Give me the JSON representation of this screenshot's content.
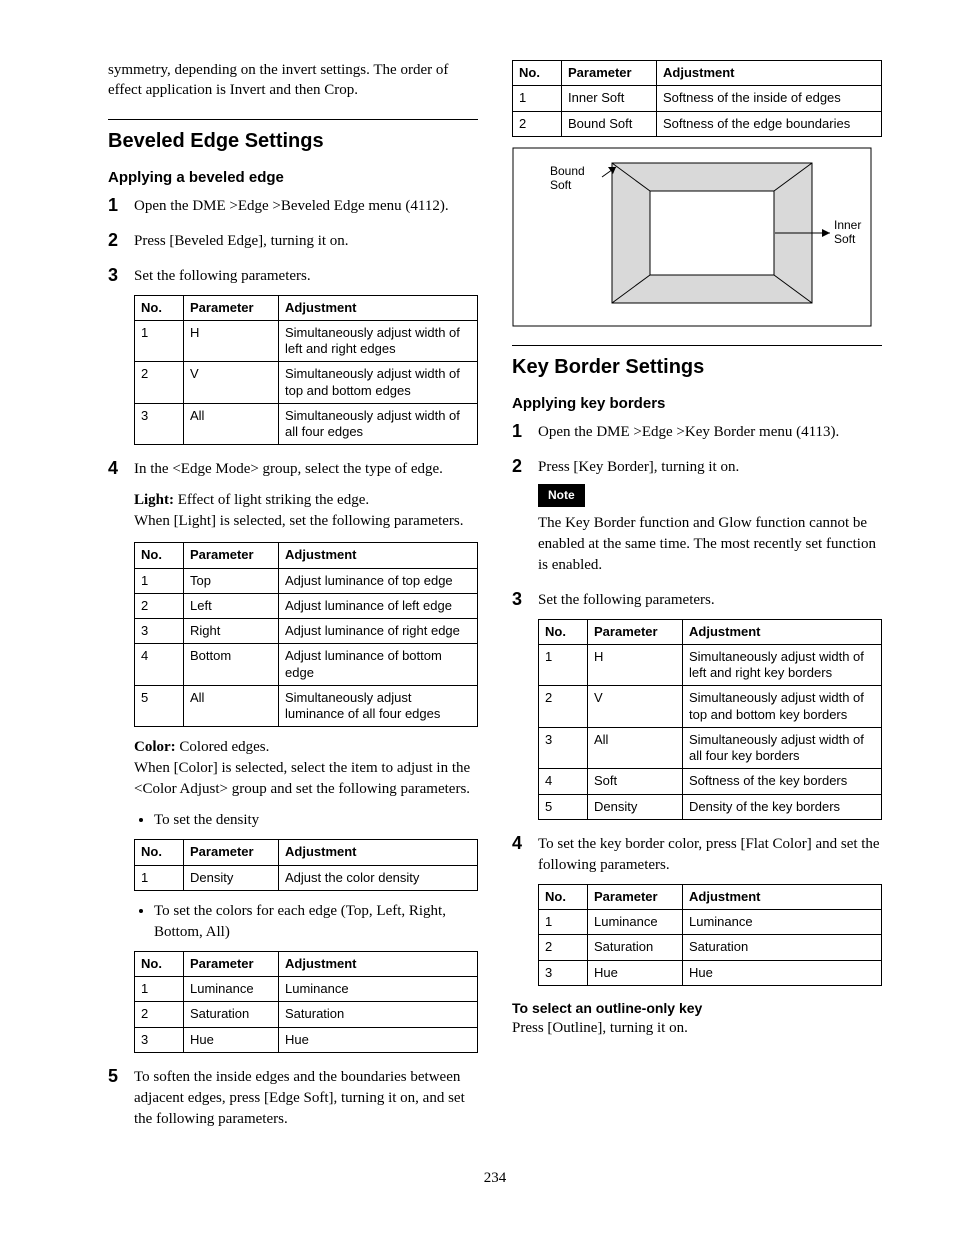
{
  "page_number": "234",
  "intro_text": "symmetry, depending on the invert settings. The order of effect application is Invert and then Crop.",
  "bevel": {
    "heading": "Beveled Edge Settings",
    "sub": "Applying a beveled edge",
    "step1": "Open the DME >Edge >Beveled Edge menu (4112).",
    "step2": "Press [Beveled Edge], turning it on.",
    "step3": "Set the following parameters.",
    "table_hvall_head": {
      "no": "No.",
      "param": "Parameter",
      "adj": "Adjustment"
    },
    "table_hvall": [
      {
        "no": "1",
        "param": "H",
        "adj": "Simultaneously adjust width of left and right edges"
      },
      {
        "no": "2",
        "param": "V",
        "adj": "Simultaneously adjust width of top and bottom edges"
      },
      {
        "no": "3",
        "param": "All",
        "adj": "Simultaneously adjust width of all four edges"
      }
    ],
    "step4": "In the <Edge Mode> group, select the type of edge.",
    "light_label": "Light:",
    "light_desc": " Effect of light striking the edge.",
    "light_note": "When [Light] is selected, set the following parameters.",
    "table_light": [
      {
        "no": "1",
        "param": "Top",
        "adj": "Adjust luminance of top edge"
      },
      {
        "no": "2",
        "param": "Left",
        "adj": "Adjust luminance of left edge"
      },
      {
        "no": "3",
        "param": "Right",
        "adj": "Adjust luminance of right edge"
      },
      {
        "no": "4",
        "param": "Bottom",
        "adj": "Adjust luminance of bottom edge"
      },
      {
        "no": "5",
        "param": "All",
        "adj": "Simultaneously adjust luminance of all four edges"
      }
    ],
    "color_label": "Color:",
    "color_desc": " Colored edges.",
    "color_note": "When [Color] is selected, select the item to adjust in the <Color Adjust> group and set the following parameters.",
    "bullet_density": "To set the density",
    "table_density": [
      {
        "no": "1",
        "param": "Density",
        "adj": "Adjust the color density"
      }
    ],
    "bullet_colors": "To set the colors for each edge (Top, Left, Right, Bottom, All)",
    "table_colors": [
      {
        "no": "1",
        "param": "Luminance",
        "adj": "Luminance"
      },
      {
        "no": "2",
        "param": "Saturation",
        "adj": "Saturation"
      },
      {
        "no": "3",
        "param": "Hue",
        "adj": "Hue"
      }
    ],
    "step5": "To soften the inside edges and the boundaries between adjacent edges, press [Edge Soft], turning it on, and set the following parameters.",
    "table_soft": [
      {
        "no": "1",
        "param": "Inner Soft",
        "adj": "Softness of the inside of edges"
      },
      {
        "no": "2",
        "param": "Bound Soft",
        "adj": "Softness of the edge boundaries"
      }
    ],
    "diagram": {
      "bound": "Bound\nSoft",
      "inner": "Inner\nSoft"
    }
  },
  "keyborder": {
    "heading": "Key Border Settings",
    "sub": "Applying key borders",
    "step1": "Open the DME >Edge >Key Border menu (4113).",
    "step2": "Press [Key Border], turning it on.",
    "note_label": "Note",
    "note_text": "The Key Border function and Glow function cannot be enabled at the same time. The most recently set function is enabled.",
    "step3": "Set the following parameters.",
    "table_kb": [
      {
        "no": "1",
        "param": "H",
        "adj": "Simultaneously adjust width of left and right key borders"
      },
      {
        "no": "2",
        "param": "V",
        "adj": "Simultaneously adjust width of top and bottom key borders"
      },
      {
        "no": "3",
        "param": "All",
        "adj": "Simultaneously adjust width of all four key borders"
      },
      {
        "no": "4",
        "param": "Soft",
        "adj": "Softness of the key borders"
      },
      {
        "no": "5",
        "param": "Density",
        "adj": "Density of the key borders"
      }
    ],
    "step4": "To set the key border color, press [Flat Color] and set the following parameters.",
    "table_flat": [
      {
        "no": "1",
        "param": "Luminance",
        "adj": "Luminance"
      },
      {
        "no": "2",
        "param": "Saturation",
        "adj": "Saturation"
      },
      {
        "no": "3",
        "param": "Hue",
        "adj": "Hue"
      }
    ],
    "outline_head": "To select an outline-only key",
    "outline_text": "Press [Outline], turning it on."
  }
}
